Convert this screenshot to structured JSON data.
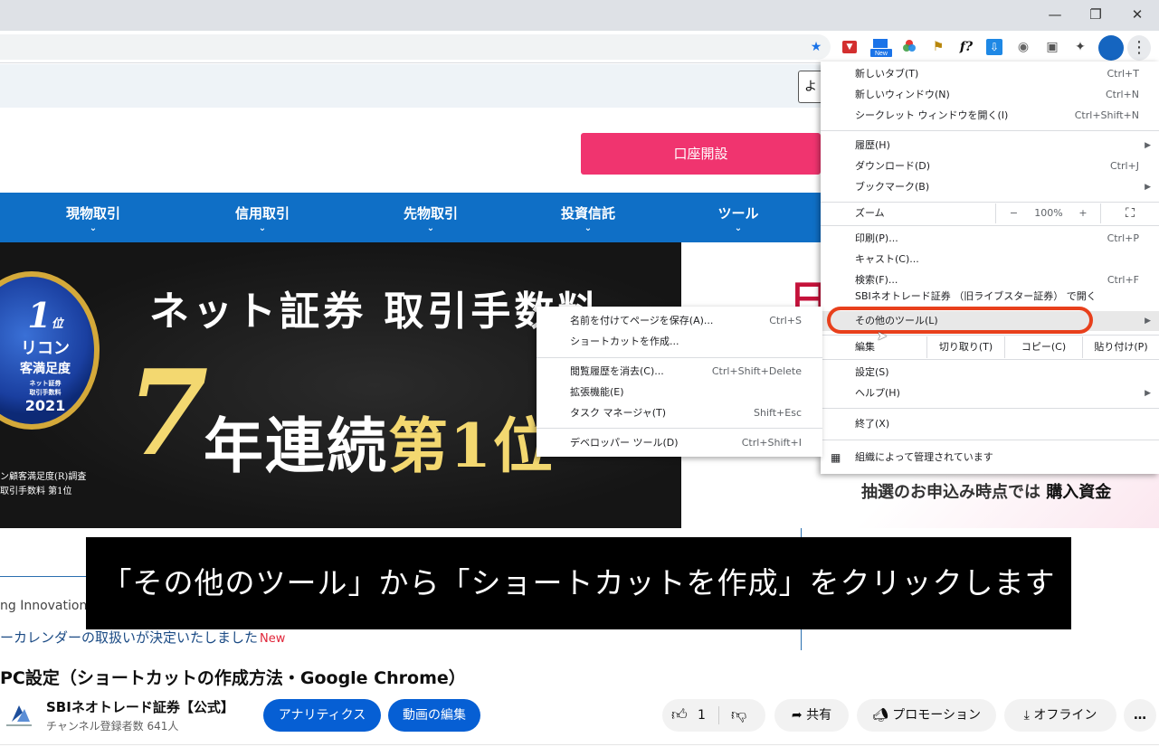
{
  "site": {
    "search_partial": "よ",
    "open_account": "口座開設",
    "nav": [
      "現物取引",
      "信用取引",
      "先物取引",
      "投資信託",
      "ツール"
    ],
    "banner": {
      "headline": "ネット証券 取引手数料",
      "big_number": "7",
      "years_text": "年連続",
      "first_place": "第1位",
      "right_char": "日",
      "badge_rank": "1",
      "badge_rank_suffix": "位",
      "badge_line1": "リコン",
      "badge_line2": "客満足度",
      "badge_small1": "ネット証券",
      "badge_small2": "取引手数料",
      "badge_year": "2021",
      "foot1": "ン顧客満足度(R)調査",
      "foot2": "取引手数料 第1位"
    },
    "below_text": "抽選のお申込み時点では",
    "below_text_bold": "購入資金",
    "news1": "ng Innovations",
    "news2": "ーカレンダーの取扱いが決定いたしました",
    "news2_badge": "New"
  },
  "subtitle": "「その他のツール」から「ショートカットを作成」をクリックします",
  "chrome_menu": {
    "new_tab": "新しいタブ(T)",
    "new_tab_sc": "Ctrl+T",
    "new_window": "新しいウィンドウ(N)",
    "new_window_sc": "Ctrl+N",
    "incognito": "シークレット ウィンドウを開く(I)",
    "incognito_sc": "Ctrl+Shift+N",
    "history": "履歴(H)",
    "downloads": "ダウンロード(D)",
    "downloads_sc": "Ctrl+J",
    "bookmarks": "ブックマーク(B)",
    "zoom": "ズーム",
    "zoom_minus": "−",
    "zoom_value": "100%",
    "zoom_plus": "+",
    "print": "印刷(P)...",
    "print_sc": "Ctrl+P",
    "cast": "キャスト(C)...",
    "find": "検索(F)...",
    "find_sc": "Ctrl+F",
    "install_app": "SBIネオトレード証券 （旧ライブスター証券） で開く",
    "more_tools": "その他のツール(L)",
    "edit": "編集",
    "cut": "切り取り(T)",
    "copy": "コピー(C)",
    "paste": "貼り付け(P)",
    "settings": "設定(S)",
    "help": "ヘルプ(H)",
    "exit": "終了(X)",
    "managed": "組織によって管理されています"
  },
  "submenu": {
    "save_page": "名前を付けてページを保存(A)...",
    "save_page_sc": "Ctrl+S",
    "create_shortcut": "ショートカットを作成...",
    "clear_data": "閲覧履歴を消去(C)...",
    "clear_data_sc": "Ctrl+Shift+Delete",
    "extensions": "拡張機能(E)",
    "task_manager": "タスク マネージャ(T)",
    "task_manager_sc": "Shift+Esc",
    "devtools": "デベロッパー ツール(D)",
    "devtools_sc": "Ctrl+Shift+I"
  },
  "youtube": {
    "title": "PC設定（ショートカットの作成方法・Google Chrome）",
    "channel_name": "SBIネオトレード証券【公式】",
    "subscribers": "チャンネル登録者数 641人",
    "analytics": "アナリティクス",
    "edit_video": "動画の編集",
    "like_count": "1",
    "share": "共有",
    "promotion": "プロモーション",
    "offline": "オフライン",
    "more": "…"
  },
  "colors": {
    "nav_blue": "#0f6fc6",
    "account_pink": "#f0346f",
    "highlight_red": "#e8401c",
    "yt_blue": "#065fd4"
  }
}
